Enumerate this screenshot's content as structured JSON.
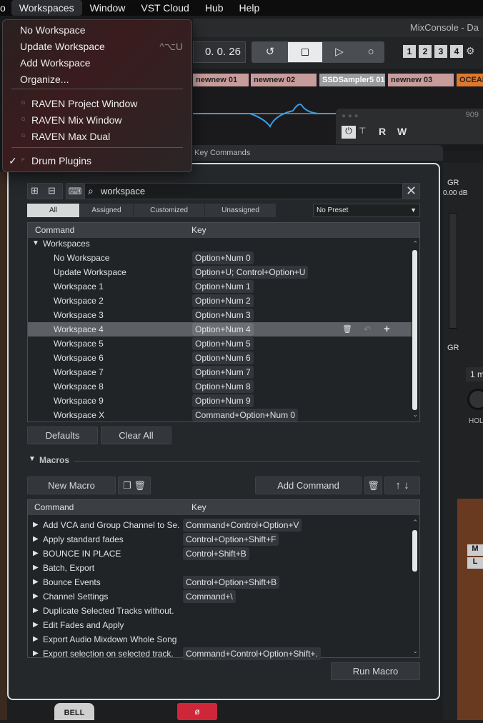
{
  "menubar": {
    "items": [
      "o",
      "Workspaces",
      "Window",
      "VST Cloud",
      "Hub",
      "Help"
    ],
    "active": "Workspaces"
  },
  "background": {
    "window_title": "MixConsole - Da",
    "time_display": "0. 0. 26",
    "channel_tabs": [
      "1",
      "2",
      "3",
      "4"
    ],
    "tracks": [
      "newnew 01",
      "newnew 02",
      "SSDSampler5 01",
      "newnew 03",
      "OCEAN"
    ],
    "plugin_title": "909",
    "plugin_buttons": [
      "R",
      "W"
    ],
    "gr_label": "GR",
    "gr_value": "0.00 dB",
    "gr_label2": "GR",
    "hold_value": "1 m",
    "hold_label": "HOL",
    "bottom_labels": [
      "BELL"
    ],
    "mixer_buttons": [
      "M",
      "L"
    ]
  },
  "workspaces_menu": {
    "items": [
      {
        "label": "No Workspace"
      },
      {
        "label": "Update Workspace",
        "shortcut": "^⌥U"
      },
      {
        "label": "Add Workspace"
      },
      {
        "label": "Organize..."
      },
      {
        "label": "RAVEN Project Window",
        "badge": "G"
      },
      {
        "label": "RAVEN Mix Window",
        "badge": "G"
      },
      {
        "label": "RAVEN Max Dual",
        "badge": "G"
      },
      {
        "label": "Drum Plugins",
        "badge": "P",
        "checked": true
      }
    ]
  },
  "key_commands": {
    "title": "Key Commands",
    "search_value": "workspace",
    "filter_tabs": [
      "All",
      "Assigned",
      "Customized",
      "Unassigned"
    ],
    "active_tab": "All",
    "preset": "No Preset",
    "columns": {
      "command": "Command",
      "key": "Key"
    },
    "folder": "Workspaces",
    "rows": [
      {
        "command": "No Workspace",
        "key": "Option+Num 0"
      },
      {
        "command": "Update Workspace",
        "key": "Option+U; Control+Option+U"
      },
      {
        "command": "Workspace 1",
        "key": "Option+Num 1"
      },
      {
        "command": "Workspace 2",
        "key": "Option+Num 2"
      },
      {
        "command": "Workspace 3",
        "key": "Option+Num 3"
      },
      {
        "command": "Workspace 4",
        "key": "Option+Num 4",
        "selected": true
      },
      {
        "command": "Workspace 5",
        "key": "Option+Num 5"
      },
      {
        "command": "Workspace 6",
        "key": "Option+Num 6"
      },
      {
        "command": "Workspace 7",
        "key": "Option+Num 7"
      },
      {
        "command": "Workspace 8",
        "key": "Option+Num 8"
      },
      {
        "command": "Workspace 9",
        "key": "Option+Num 9"
      },
      {
        "command": "Workspace X",
        "key": "Command+Option+Num 0"
      }
    ],
    "defaults_label": "Defaults",
    "clear_all_label": "Clear All",
    "macros": {
      "section_label": "Macros",
      "new_macro_label": "New Macro",
      "add_command_label": "Add Command",
      "columns": {
        "command": "Command",
        "key": "Key"
      },
      "rows": [
        {
          "command": "Add VCA and Group Channel to Se.",
          "key": "Command+Control+Option+V"
        },
        {
          "command": "Apply standard fades",
          "key": "Control+Option+Shift+F"
        },
        {
          "command": "BOUNCE IN PLACE",
          "key": "Control+Shift+B"
        },
        {
          "command": "Batch, Export",
          "key": ""
        },
        {
          "command": "Bounce Events",
          "key": "Control+Option+Shift+B"
        },
        {
          "command": "Channel Settings",
          "key": "Command+\\"
        },
        {
          "command": "Duplicate Selected Tracks without.",
          "key": ""
        },
        {
          "command": "Edit Fades and Apply",
          "key": ""
        },
        {
          "command": "Export Audio Mixdown Whole Song",
          "key": ""
        },
        {
          "command": "Export selection on selected track.",
          "key": "Command+Control+Option+Shift+."
        }
      ],
      "run_macro_label": "Run Macro"
    }
  }
}
